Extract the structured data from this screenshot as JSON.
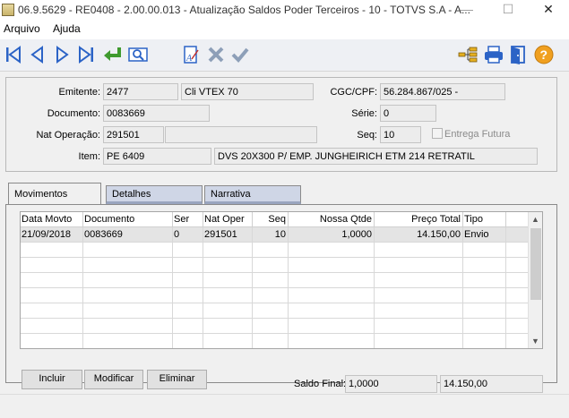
{
  "window": {
    "title": "06.9.5629 - RE0408 - 2.00.00.013 - Atualização Saldos Poder Terceiros - 10 - TOTVS S.A - A...",
    "minimize": "—",
    "maximize": "☐",
    "close": "✕"
  },
  "menu": [
    "Arquivo",
    "Ajuda"
  ],
  "toolbar": {
    "colors": {
      "blue": "#2b63c6",
      "green": "#3f9a2e",
      "orange": "#f0a020"
    },
    "icons": [
      "first-icon",
      "previous-icon",
      "next-icon",
      "last-icon",
      "goto-icon",
      "search-icon",
      "edit-icon",
      "cancel-icon",
      "confirm-icon",
      "tree-icon",
      "print-icon",
      "exit-icon",
      "help-icon"
    ]
  },
  "header": {
    "emitente_label": "Emitente:",
    "emitente_code": "2477",
    "emitente_name": "Cli VTEX 70",
    "cgc_label": "CGC/CPF:",
    "cgc_value": "56.284.867/025 -",
    "documento_label": "Documento:",
    "documento_value": "0083669",
    "serie_label": "Série:",
    "serie_value": "0",
    "natop_label": "Nat Operação:",
    "natop_value": "291501",
    "natop_desc": "",
    "seq_label": "Seq:",
    "seq_value": "10",
    "entrega_futura_label": "Entrega Futura",
    "item_label": "Item:",
    "item_code": "PE 6409",
    "item_desc": "DVS 20X300 P/ EMP. JUNGHEIRICH ETM 214 RETRATIL"
  },
  "tabs": [
    "Movimentos",
    "Detalhes",
    "Narrativa"
  ],
  "grid": {
    "columns": [
      "Data Movto",
      "Documento",
      "Ser",
      "Nat Oper",
      "Seq",
      "Nossa Qtde",
      "Preço Total",
      "Tipo"
    ],
    "rows": [
      [
        "21/09/2018",
        "0083669",
        "0",
        "291501",
        "10",
        "1,0000",
        "14.150,00",
        "Envio"
      ]
    ],
    "scroll_up": "▲",
    "scroll_down": "▼"
  },
  "buttons": {
    "incluir": "Incluir",
    "modificar": "Modificar",
    "eliminar": "Eliminar"
  },
  "saldo": {
    "label": "Saldo Final:",
    "qtde": "1,0000",
    "valor": "14.150,00"
  }
}
